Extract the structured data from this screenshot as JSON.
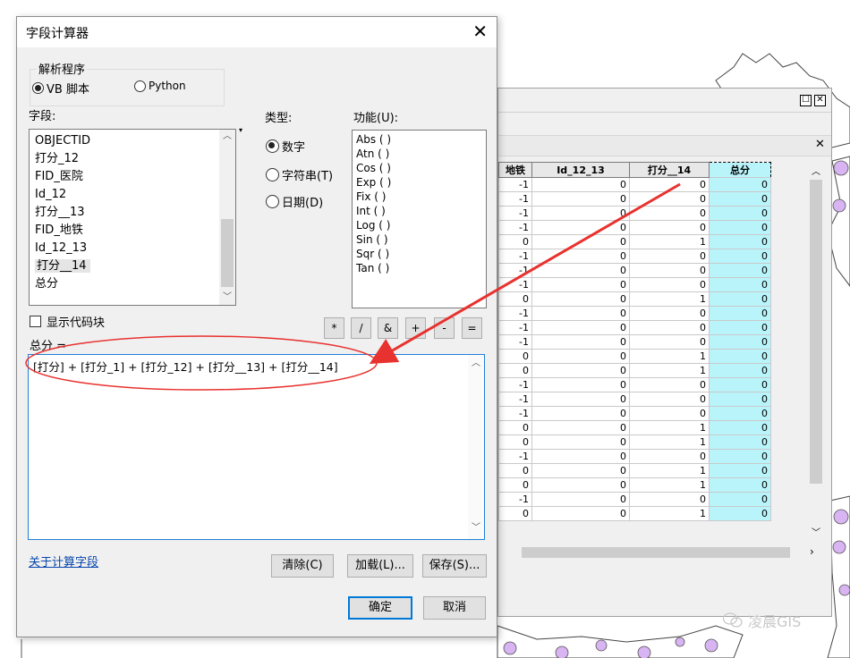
{
  "dialog": {
    "title": "字段计算器",
    "parser_group": "解析程序",
    "parser_options": [
      {
        "label": "VB 脚本",
        "selected": true
      },
      {
        "label": "Python",
        "selected": false
      }
    ],
    "fields_label": "字段:",
    "fields": [
      "OBJECTID",
      "打分_12",
      "FID_医院",
      "Id_12",
      "打分__13",
      "FID_地铁",
      "Id_12_13",
      "打分__14",
      "总分"
    ],
    "selected_field": "打分__14",
    "type_label": "类型:",
    "type_options": [
      {
        "label": "数字",
        "selected": true
      },
      {
        "label": "字符串(T)",
        "selected": false
      },
      {
        "label": "日期(D)",
        "selected": false
      }
    ],
    "functions_label": "功能(U):",
    "functions": [
      "Abs ( )",
      "Atn ( )",
      "Cos ( )",
      "Exp ( )",
      "Fix ( )",
      "Int ( )",
      "Log ( )",
      "Sin ( )",
      "Sqr ( )",
      "Tan ( )"
    ],
    "show_codeblock_label": "显示代码块",
    "operators": [
      "*",
      "/",
      "&",
      "+",
      "-",
      "="
    ],
    "expression_label": "总分 =",
    "expression": "[打分] + [打分_1] + [打分_12] + [打分__13] + [打分__14]",
    "about_link": "关于计算字段",
    "clear_button": "清除(C)",
    "load_button": "加载(L)...",
    "save_button": "保存(S)...",
    "ok_button": "确定",
    "cancel_button": "取消",
    "close_glyph": "✕"
  },
  "table": {
    "headers": [
      "地铁",
      "Id_12_13",
      "打分__14",
      "总分"
    ],
    "rows": [
      [
        "-1",
        "0",
        "0",
        "0"
      ],
      [
        "-1",
        "0",
        "0",
        "0"
      ],
      [
        "-1",
        "0",
        "0",
        "0"
      ],
      [
        "-1",
        "0",
        "0",
        "0"
      ],
      [
        "0",
        "0",
        "1",
        "0"
      ],
      [
        "-1",
        "0",
        "0",
        "0"
      ],
      [
        "-1",
        "0",
        "0",
        "0"
      ],
      [
        "-1",
        "0",
        "0",
        "0"
      ],
      [
        "0",
        "0",
        "1",
        "0"
      ],
      [
        "-1",
        "0",
        "0",
        "0"
      ],
      [
        "-1",
        "0",
        "0",
        "0"
      ],
      [
        "-1",
        "0",
        "0",
        "0"
      ],
      [
        "0",
        "0",
        "1",
        "0"
      ],
      [
        "0",
        "0",
        "1",
        "0"
      ],
      [
        "-1",
        "0",
        "0",
        "0"
      ],
      [
        "-1",
        "0",
        "0",
        "0"
      ],
      [
        "-1",
        "0",
        "0",
        "0"
      ],
      [
        "0",
        "0",
        "1",
        "0"
      ],
      [
        "0",
        "0",
        "1",
        "0"
      ],
      [
        "-1",
        "0",
        "0",
        "0"
      ],
      [
        "0",
        "0",
        "1",
        "0"
      ],
      [
        "0",
        "0",
        "1",
        "0"
      ],
      [
        "-1",
        "0",
        "0",
        "0"
      ],
      [
        "0",
        "0",
        "1",
        "0"
      ]
    ],
    "maximize_glyph": "☐",
    "close_glyph": "✕"
  },
  "watermark": "凌晨GIS",
  "colors": {
    "highlight_column": "#b9f4fb",
    "arrow": "#e8322f",
    "ellipse": "#e8322f",
    "link": "#0645ad"
  }
}
